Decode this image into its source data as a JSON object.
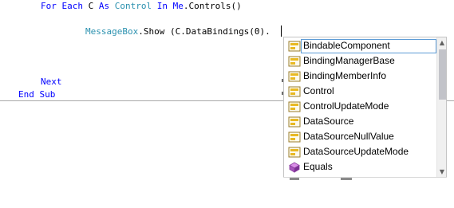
{
  "code": {
    "line1": {
      "kw_for": "For",
      "kw_each": "Each",
      "var": "C",
      "kw_as": "As",
      "type": "Control",
      "kw_in": "In",
      "kw_me": "Me",
      "rest": ".Controls()"
    },
    "line2": {
      "type": "MessageBox",
      "rest": ".Show (C.DataBindings(0)."
    },
    "line3": {
      "kw": "Next"
    },
    "line4": {
      "kw_end": "End",
      "kw_sub": "Sub"
    }
  },
  "completion": {
    "items": [
      {
        "label": "BindableComponent",
        "icon": "class-icon",
        "selected": true
      },
      {
        "label": "BindingManagerBase",
        "icon": "class-icon"
      },
      {
        "label": "BindingMemberInfo",
        "icon": "class-icon"
      },
      {
        "label": "Control",
        "icon": "class-icon"
      },
      {
        "label": "ControlUpdateMode",
        "icon": "class-icon"
      },
      {
        "label": "DataSource",
        "icon": "class-icon"
      },
      {
        "label": "DataSourceNullValue",
        "icon": "class-icon"
      },
      {
        "label": "DataSourceUpdateMode",
        "icon": "class-icon"
      },
      {
        "label": "Equals",
        "icon": "method-icon"
      }
    ]
  },
  "colors": {
    "keyword": "#0000ff",
    "type": "#2b91af",
    "selection_border": "#5c9bd6"
  }
}
